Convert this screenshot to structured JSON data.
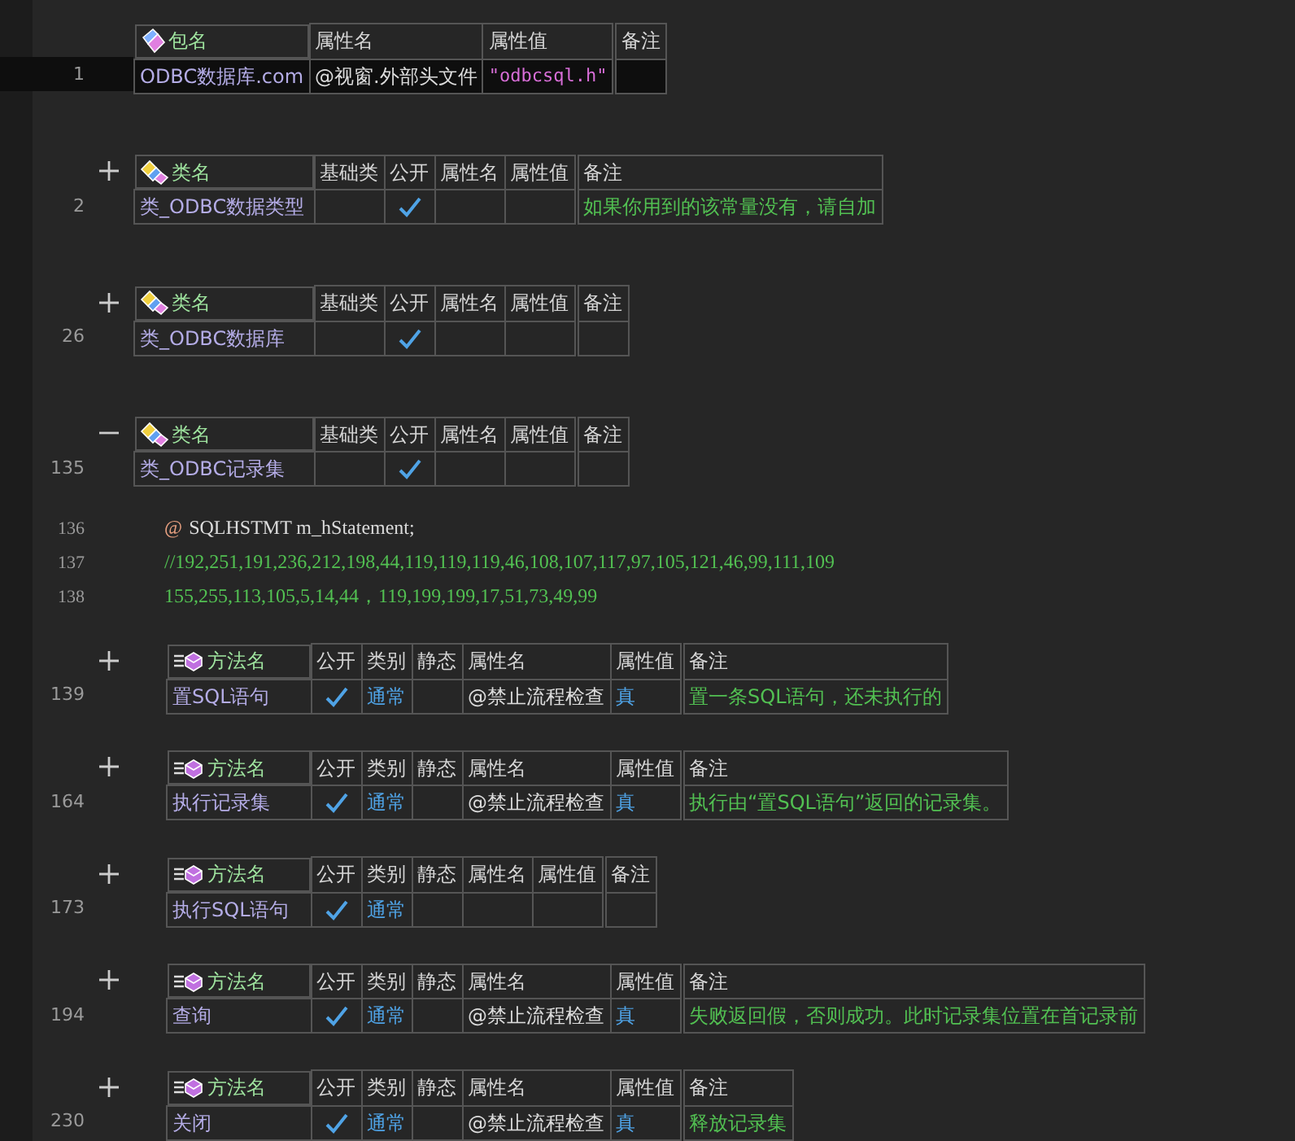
{
  "blocks": [
    {
      "kind": "package",
      "line": "1",
      "current": true,
      "columns": [
        "包名",
        "属性名",
        "属性值",
        "备注"
      ],
      "cells": [
        {
          "kind": "name",
          "text": "ODBC数据库.com"
        },
        {
          "kind": "text",
          "text": "@视窗.外部头文件"
        },
        {
          "kind": "string",
          "text": "\"odbcsql.h\""
        },
        {
          "kind": "blank"
        }
      ]
    },
    {
      "kind": "class",
      "line": "2",
      "current": false,
      "expanded": false,
      "columns": [
        "类名",
        "基础类",
        "公开",
        "属性名",
        "属性值",
        "备注"
      ],
      "cells": [
        {
          "kind": "name",
          "text": "类_ODBC数据类型"
        },
        {
          "kind": "blank"
        },
        {
          "kind": "check",
          "checked": true
        },
        {
          "kind": "blank"
        },
        {
          "kind": "blank"
        },
        {
          "kind": "note",
          "text": "如果你用到的该常量没有，请自加"
        }
      ]
    },
    {
      "kind": "class",
      "line": "26",
      "current": false,
      "expanded": false,
      "columns": [
        "类名",
        "基础类",
        "公开",
        "属性名",
        "属性值",
        "备注"
      ],
      "cells": [
        {
          "kind": "name",
          "text": "类_ODBC数据库"
        },
        {
          "kind": "blank"
        },
        {
          "kind": "check",
          "checked": true
        },
        {
          "kind": "blank"
        },
        {
          "kind": "blank"
        },
        {
          "kind": "blank"
        }
      ]
    },
    {
      "kind": "class",
      "line": "135",
      "current": false,
      "expanded": true,
      "columns": [
        "类名",
        "基础类",
        "公开",
        "属性名",
        "属性值",
        "备注"
      ],
      "cells": [
        {
          "kind": "name",
          "text": "类_ODBC记录集"
        },
        {
          "kind": "blank"
        },
        {
          "kind": "check",
          "checked": true
        },
        {
          "kind": "blank"
        },
        {
          "kind": "blank"
        },
        {
          "kind": "blank"
        }
      ]
    },
    {
      "kind": "code",
      "lines": [
        {
          "kind": "member",
          "line": "136",
          "mark": "@",
          "text": "SQLHSTMT m_hStatement;"
        },
        {
          "kind": "comment",
          "line": "137",
          "text": "//192,251,191,236,212,198,44,119,119,119,46,108,107,117,97,105,121,46,99,111,109"
        },
        {
          "kind": "comment",
          "line": "138",
          "text": "155,255,113,105,5,14,44，119,199,199,17,51,73,49,99"
        }
      ]
    },
    {
      "kind": "method",
      "line": "139",
      "current": false,
      "expanded": false,
      "columns": [
        "方法名",
        "公开",
        "类别",
        "静态",
        "属性名",
        "属性值",
        "备注"
      ],
      "cells": [
        {
          "kind": "name",
          "text": "置SQL语句"
        },
        {
          "kind": "check",
          "checked": true
        },
        {
          "kind": "keyword",
          "text": "通常"
        },
        {
          "kind": "blank"
        },
        {
          "kind": "text",
          "text": "@禁止流程检查"
        },
        {
          "kind": "keyword",
          "text": "真"
        },
        {
          "kind": "note",
          "text": "置一条SQL语句，还未执行的"
        }
      ]
    },
    {
      "kind": "method",
      "line": "164",
      "current": false,
      "expanded": false,
      "columns": [
        "方法名",
        "公开",
        "类别",
        "静态",
        "属性名",
        "属性值",
        "备注"
      ],
      "cells": [
        {
          "kind": "name",
          "text": "执行记录集"
        },
        {
          "kind": "check",
          "checked": true
        },
        {
          "kind": "keyword",
          "text": "通常"
        },
        {
          "kind": "blank"
        },
        {
          "kind": "text",
          "text": "@禁止流程检查"
        },
        {
          "kind": "keyword",
          "text": "真"
        },
        {
          "kind": "note",
          "text": "执行由“置SQL语句”返回的记录集。"
        }
      ]
    },
    {
      "kind": "method",
      "line": "173",
      "current": false,
      "expanded": false,
      "columns": [
        "方法名",
        "公开",
        "类别",
        "静态",
        "属性名",
        "属性值",
        "备注"
      ],
      "cells": [
        {
          "kind": "name",
          "text": "执行SQL语句"
        },
        {
          "kind": "check",
          "checked": true
        },
        {
          "kind": "keyword",
          "text": "通常"
        },
        {
          "kind": "blank"
        },
        {
          "kind": "blank"
        },
        {
          "kind": "blank"
        },
        {
          "kind": "blank"
        }
      ]
    },
    {
      "kind": "method",
      "line": "194",
      "current": false,
      "expanded": false,
      "columns": [
        "方法名",
        "公开",
        "类别",
        "静态",
        "属性名",
        "属性值",
        "备注"
      ],
      "cells": [
        {
          "kind": "name",
          "text": "查询"
        },
        {
          "kind": "check",
          "checked": true
        },
        {
          "kind": "keyword",
          "text": "通常"
        },
        {
          "kind": "blank"
        },
        {
          "kind": "text",
          "text": "@禁止流程检查"
        },
        {
          "kind": "keyword",
          "text": "真"
        },
        {
          "kind": "note",
          "text": "失败返回假，否则成功。此时记录集位置在首记录前"
        }
      ]
    },
    {
      "kind": "method",
      "line": "230",
      "current": false,
      "expanded": false,
      "columns": [
        "方法名",
        "公开",
        "类别",
        "静态",
        "属性名",
        "属性值",
        "备注"
      ],
      "cells": [
        {
          "kind": "name",
          "text": "关闭"
        },
        {
          "kind": "check",
          "checked": true
        },
        {
          "kind": "keyword",
          "text": "通常"
        },
        {
          "kind": "blank"
        },
        {
          "kind": "text",
          "text": "@禁止流程检查"
        },
        {
          "kind": "keyword",
          "text": "真"
        },
        {
          "kind": "note",
          "text": "释放记录集"
        }
      ]
    }
  ]
}
